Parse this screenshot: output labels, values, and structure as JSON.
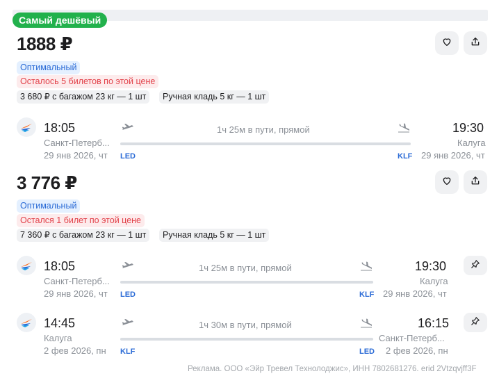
{
  "badge": "Самый дешёвый",
  "cards": [
    {
      "price": "1888 ₽",
      "tags": {
        "optimal": "Оптимальный",
        "warning": "Осталось 5 билетов по этой цене",
        "baggage": "3 680 ₽ с багажом 23 кг — 1 шт",
        "hand_luggage": "Ручная кладь 5 кг — 1 шт"
      },
      "segments": [
        {
          "dep_time": "18:05",
          "dep_city": "Санкт-Петерб...",
          "dep_date": "29 янв 2026, чт",
          "dep_code": "LED",
          "duration": "1ч 25м в пути, прямой",
          "arr_time": "19:30",
          "arr_city": "Калуга",
          "arr_date": "29 янв 2026, чт",
          "arr_code": "KLF"
        }
      ]
    },
    {
      "price": "3 776 ₽",
      "tags": {
        "optimal": "Оптимальный",
        "warning": "Остался 1 билет по этой цене",
        "baggage": "7 360 ₽ с багажом 23 кг — 1 шт",
        "hand_luggage": "Ручная кладь 5 кг — 1 шт"
      },
      "segments": [
        {
          "dep_time": "18:05",
          "dep_city": "Санкт-Петерб...",
          "dep_date": "29 янв 2026, чт",
          "dep_code": "LED",
          "duration": "1ч 25м в пути, прямой",
          "arr_time": "19:30",
          "arr_city": "Калуга",
          "arr_date": "29 янв 2026, чт",
          "arr_code": "KLF"
        },
        {
          "dep_time": "14:45",
          "dep_city": "Калуга",
          "dep_date": "2 фев 2026, пн",
          "dep_code": "KLF",
          "duration": "1ч 30м в пути, прямой",
          "arr_time": "16:15",
          "arr_city": "Санкт-Петерб...",
          "arr_date": "2 фев 2026, пн",
          "arr_code": "LED"
        }
      ]
    }
  ],
  "ad_text": "Реклама. ООО «Эйр Тревел Технолоджис», ИНН 7802681276. erid 2Vtzqvjff3F",
  "icons": [
    "heart-icon",
    "share-icon",
    "airline-logo-icon",
    "takeoff-icon",
    "landing-icon",
    "pin-icon"
  ],
  "colors": {
    "badge_green": "#22b14c",
    "accent_blue": "#2b6bd6",
    "warning_red": "#e2424a"
  }
}
